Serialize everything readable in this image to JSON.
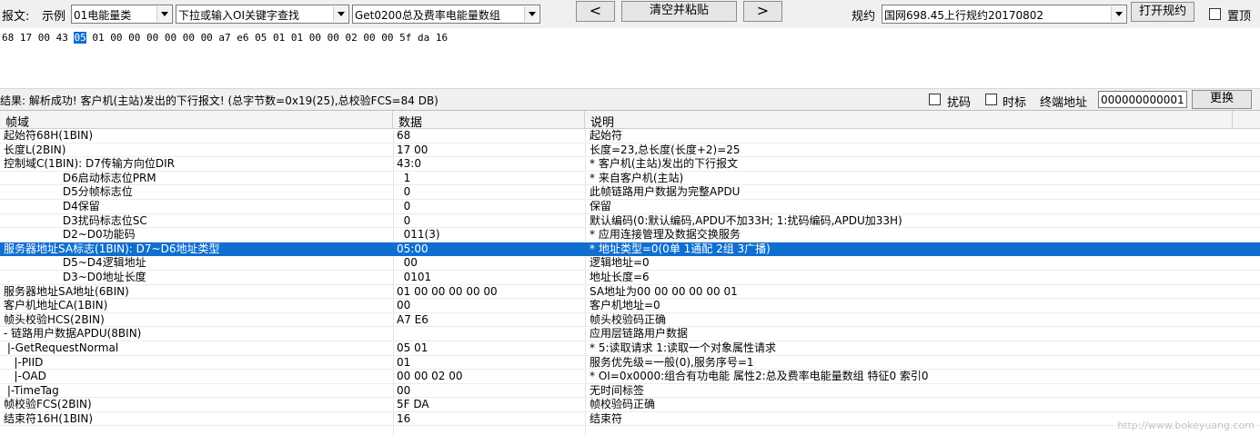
{
  "toolbar": {
    "message_label": "报文:",
    "example_label": "示例",
    "example_select": "01电能量类",
    "keyword_select": "下拉或输入OI关键字查找",
    "template_select": "Get0200总及费率电能量数组",
    "prev_label": "<",
    "clear_paste_label": "清空并粘贴",
    "next_label": ">",
    "protocol_label": "规约",
    "protocol_select": "国网698.45上行规约20170802",
    "open_protocol_label": "打开规约",
    "topmost_label": "置顶"
  },
  "hex": {
    "before": "68 17 00 43 ",
    "selected": "05",
    "after": " 01 00 00 00 00 00 00 a7 e6 05 01 01 00 00 02 00 00 5f da 16"
  },
  "result": {
    "text": "结果: 解析成功! 客户机(主站)发出的下行报文! (总字节数=0x19(25),总校验FCS=84 DB)",
    "scramble_label": "扰码",
    "timestamp_label": "时标",
    "terminal_addr_label": "终端地址",
    "terminal_addr_value": "000000000001",
    "change_label": "更换"
  },
  "columns": [
    "帧域",
    "数据",
    "说明"
  ],
  "rows": [
    {
      "field": "起始符68H(1BIN)",
      "data": "68",
      "desc": "起始符",
      "selected": false
    },
    {
      "field": "长度L(2BIN)",
      "data": "17 00",
      "desc": "长度=23,总长度(长度+2)=25",
      "selected": false
    },
    {
      "field": "控制域C(1BIN): D7传输方向位DIR",
      "data": "43:0",
      "desc": "* 客户机(主站)发出的下行报文",
      "selected": false
    },
    {
      "field": "                 D6启动标志位PRM",
      "data": "  1",
      "desc": "* 来自客户机(主站)",
      "selected": false
    },
    {
      "field": "                 D5分帧标志位",
      "data": "  0",
      "desc": "此帧链路用户数据为完整APDU",
      "selected": false
    },
    {
      "field": "                 D4保留",
      "data": "  0",
      "desc": "保留",
      "selected": false
    },
    {
      "field": "                 D3扰码标志位SC",
      "data": "  0",
      "desc": "默认编码(0:默认编码,APDU不加33H; 1:扰码编码,APDU加33H)",
      "selected": false
    },
    {
      "field": "                 D2~D0功能码",
      "data": "  011(3)",
      "desc": "* 应用连接管理及数据交换服务",
      "selected": false
    },
    {
      "field": "服务器地址SA标志(1BIN): D7~D6地址类型",
      "data": "05:00",
      "desc": "* 地址类型=0(0单 1通配 2组 3广播)",
      "selected": true
    },
    {
      "field": "                 D5~D4逻辑地址",
      "data": "  00",
      "desc": "逻辑地址=0",
      "selected": false
    },
    {
      "field": "                 D3~D0地址长度",
      "data": "  0101",
      "desc": "地址长度=6",
      "selected": false
    },
    {
      "field": "服务器地址SA地址(6BIN)",
      "data": "01 00 00 00 00 00",
      "desc": "SA地址为00 00 00 00 00 01",
      "selected": false
    },
    {
      "field": "客户机地址CA(1BIN)",
      "data": "00",
      "desc": "客户机地址=0",
      "selected": false
    },
    {
      "field": "帧头校验HCS(2BIN)",
      "data": "A7 E6",
      "desc": "帧头校验码正确",
      "selected": false
    },
    {
      "field": "- 链路用户数据APDU(8BIN)",
      "data": "",
      "desc": "应用层链路用户数据",
      "selected": false
    },
    {
      "field": " |-GetRequestNormal",
      "data": "05 01",
      "desc": "* 5:读取请求 1:读取一个对象属性请求",
      "selected": false
    },
    {
      "field": "   |-PIID",
      "data": "01",
      "desc": "服务优先级=一般(0),服务序号=1",
      "selected": false
    },
    {
      "field": "   |-OAD",
      "data": "00 00 02 00",
      "desc": "* OI=0x0000:组合有功电能 属性2:总及费率电能量数组 特征0 索引0",
      "selected": false
    },
    {
      "field": " |-TimeTag",
      "data": "00",
      "desc": "无时间标签",
      "selected": false
    },
    {
      "field": "帧校验FCS(2BIN)",
      "data": "5F DA",
      "desc": "帧校验码正确",
      "selected": false
    },
    {
      "field": "结束符16H(1BIN)",
      "data": "16",
      "desc": "结束符",
      "selected": false
    }
  ],
  "watermark": "http://www.bokeyuang.com"
}
